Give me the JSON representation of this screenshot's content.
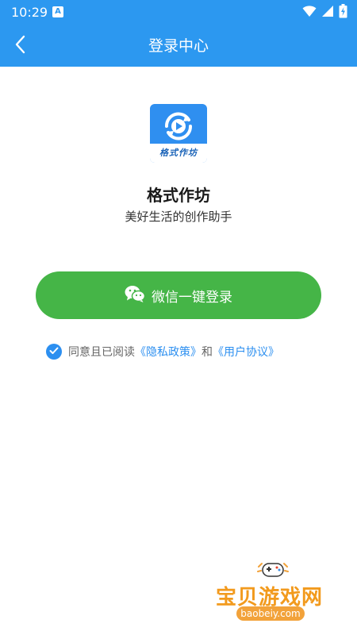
{
  "status_bar": {
    "time": "10:29",
    "notification_icon": "a-icon",
    "wifi_icon": "wifi-icon",
    "signal_icon": "signal-icon",
    "battery_icon": "battery-charging-icon"
  },
  "app_bar": {
    "back_icon": "chevron-left-icon",
    "title": "登录中心"
  },
  "app_info": {
    "logo_icon": "refresh-play-icon",
    "logo_caption": "格式作坊",
    "name": "格式作坊",
    "slogan": "美好生活的创作助手"
  },
  "login": {
    "wechat_icon": "wechat-icon",
    "button_label": "微信一键登录"
  },
  "agreement": {
    "checked": true,
    "prefix": "同意且已阅读",
    "privacy_link": "《隐私政策》",
    "conjunction": "和",
    "user_link": "《用户协议》"
  },
  "watermark": {
    "text": "宝贝游戏网",
    "url": "baobeiy.com"
  },
  "colors": {
    "primary": "#2c98f0",
    "wechat_green": "#45b547",
    "link_blue": "#2c8ff0"
  }
}
